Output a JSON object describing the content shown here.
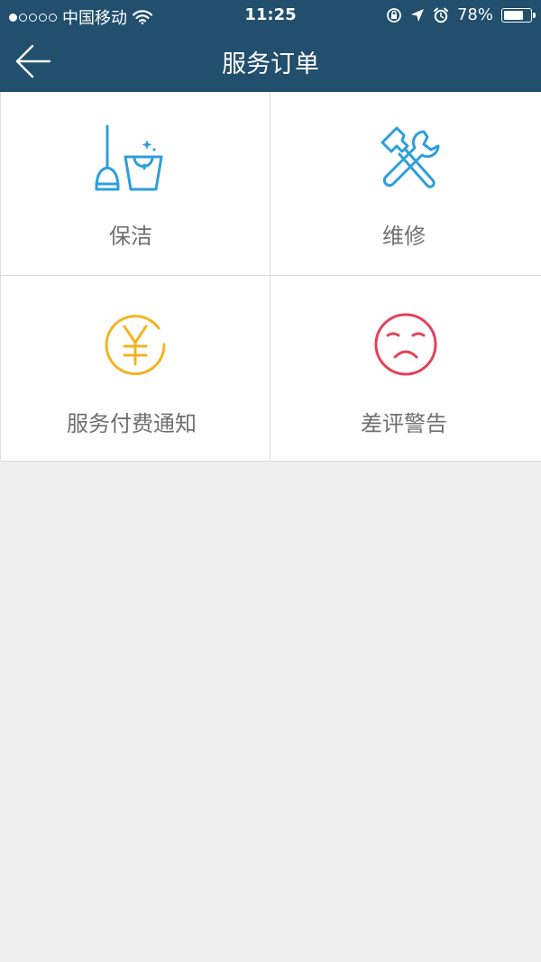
{
  "status_bar": {
    "carrier": "中国移动",
    "time": "11:25",
    "battery_percent_text": "78%",
    "battery_level": 0.78,
    "signal_bars_filled": 1,
    "signal_bars_total": 5
  },
  "header": {
    "title": "服务订单",
    "background_color": "#214f6d"
  },
  "tiles": [
    {
      "label": "保洁",
      "icon": "mop-bucket-icon",
      "color": "#2d9fd9"
    },
    {
      "label": "维修",
      "icon": "hammer-wrench-icon",
      "color": "#2d9fd9"
    },
    {
      "label": "服务付费通知",
      "icon": "yen-coin-icon",
      "color": "#f5b324"
    },
    {
      "label": "差评警告",
      "icon": "sad-face-icon",
      "color": "#e2435a"
    }
  ]
}
